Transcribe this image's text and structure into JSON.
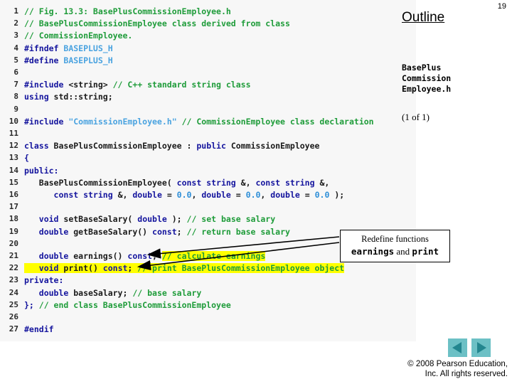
{
  "page": {
    "number": "19",
    "background": "#ffffff"
  },
  "outline": {
    "title": "Outline",
    "filename_lines": [
      "BasePlus",
      "Commission",
      "Employee.h"
    ],
    "count_label": "(1 of 1)"
  },
  "code_panel": {
    "background": "#f7f7f7",
    "highlight_color": "#ffff00",
    "lines": [
      {
        "n": "1",
        "segments": [
          {
            "t": "// Fig. 13.3: BasePlusCommissionEmployee.h",
            "c": "tok-com"
          }
        ]
      },
      {
        "n": "2",
        "segments": [
          {
            "t": "// BasePlusCommissionEmployee class derived from class",
            "c": "tok-com"
          }
        ]
      },
      {
        "n": "3",
        "segments": [
          {
            "t": "// CommissionEmployee.",
            "c": "tok-com"
          }
        ]
      },
      {
        "n": "4",
        "segments": [
          {
            "t": "#ifndef ",
            "c": "tok-pre"
          },
          {
            "t": "BASEPLUS_H",
            "c": "tok-macro"
          }
        ]
      },
      {
        "n": "5",
        "segments": [
          {
            "t": "#define ",
            "c": "tok-pre"
          },
          {
            "t": "BASEPLUS_H",
            "c": "tok-macro"
          }
        ]
      },
      {
        "n": "6",
        "segments": []
      },
      {
        "n": "7",
        "segments": [
          {
            "t": "#include ",
            "c": "tok-pre"
          },
          {
            "t": "<string>",
            "c": "tok-id"
          },
          {
            "t": " // C++ standard string class",
            "c": "tok-com"
          }
        ]
      },
      {
        "n": "8",
        "segments": [
          {
            "t": "using ",
            "c": "tok-key"
          },
          {
            "t": "std::string;",
            "c": "tok-id"
          }
        ]
      },
      {
        "n": "9",
        "segments": []
      },
      {
        "n": "10",
        "segments": [
          {
            "t": "#include ",
            "c": "tok-pre"
          },
          {
            "t": "\"CommissionEmployee.h\"",
            "c": "tok-str"
          },
          {
            "t": " // CommissionEmployee class declaration",
            "c": "tok-com"
          }
        ]
      },
      {
        "n": "11",
        "segments": []
      },
      {
        "n": "12",
        "segments": [
          {
            "t": "class ",
            "c": "tok-key"
          },
          {
            "t": "BasePlusCommissionEmployee : ",
            "c": "tok-id"
          },
          {
            "t": "public ",
            "c": "tok-key"
          },
          {
            "t": "CommissionEmployee",
            "c": "tok-id"
          }
        ]
      },
      {
        "n": "13",
        "segments": [
          {
            "t": "{",
            "c": "tok-key"
          }
        ]
      },
      {
        "n": "14",
        "segments": [
          {
            "t": "public:",
            "c": "tok-key"
          }
        ]
      },
      {
        "n": "15",
        "segments": [
          {
            "t": "   BasePlusCommissionEmployee( ",
            "c": "tok-id"
          },
          {
            "t": "const string ",
            "c": "tok-key"
          },
          {
            "t": "&, ",
            "c": "tok-id"
          },
          {
            "t": "const string ",
            "c": "tok-key"
          },
          {
            "t": "&,",
            "c": "tok-id"
          }
        ]
      },
      {
        "n": "16",
        "segments": [
          {
            "t": "      ",
            "c": "tok-id"
          },
          {
            "t": "const string ",
            "c": "tok-key"
          },
          {
            "t": "&, ",
            "c": "tok-id"
          },
          {
            "t": "double ",
            "c": "tok-key"
          },
          {
            "t": "= ",
            "c": "tok-id"
          },
          {
            "t": "0.0",
            "c": "tok-num"
          },
          {
            "t": ", ",
            "c": "tok-id"
          },
          {
            "t": "double ",
            "c": "tok-key"
          },
          {
            "t": "= ",
            "c": "tok-id"
          },
          {
            "t": "0.0",
            "c": "tok-num"
          },
          {
            "t": ", ",
            "c": "tok-id"
          },
          {
            "t": "double ",
            "c": "tok-key"
          },
          {
            "t": "= ",
            "c": "tok-id"
          },
          {
            "t": "0.0",
            "c": "tok-num"
          },
          {
            "t": " );",
            "c": "tok-id"
          }
        ]
      },
      {
        "n": "17",
        "segments": []
      },
      {
        "n": "18",
        "segments": [
          {
            "t": "   ",
            "c": "tok-id"
          },
          {
            "t": "void ",
            "c": "tok-key"
          },
          {
            "t": "setBaseSalary( ",
            "c": "tok-id"
          },
          {
            "t": "double ",
            "c": "tok-key"
          },
          {
            "t": "); ",
            "c": "tok-id"
          },
          {
            "t": "// set base salary",
            "c": "tok-com"
          }
        ]
      },
      {
        "n": "19",
        "segments": [
          {
            "t": "   ",
            "c": "tok-id"
          },
          {
            "t": "double ",
            "c": "tok-key"
          },
          {
            "t": "getBaseSalary() ",
            "c": "tok-id"
          },
          {
            "t": "const",
            "c": "tok-key"
          },
          {
            "t": "; ",
            "c": "tok-id"
          },
          {
            "t": "// return base salary",
            "c": "tok-com"
          }
        ]
      },
      {
        "n": "20",
        "segments": []
      },
      {
        "n": "21",
        "segments": [
          {
            "t": "   ",
            "c": "tok-id"
          },
          {
            "t": "double ",
            "c": "tok-key"
          },
          {
            "t": "earnings() ",
            "c": "tok-id"
          },
          {
            "t": "const",
            "c": "tok-key"
          },
          {
            "t": "; ",
            "c": "tok-id"
          },
          {
            "t": "// calculate earnings",
            "c": "tok-com",
            "hl": true
          }
        ]
      },
      {
        "n": "22",
        "segments": [
          {
            "t": "   ",
            "c": "tok-id",
            "hl": true
          },
          {
            "t": "void ",
            "c": "tok-key",
            "hl": true
          },
          {
            "t": "print() ",
            "c": "tok-id",
            "hl": true
          },
          {
            "t": "const",
            "c": "tok-key",
            "hl": true
          },
          {
            "t": "; ",
            "c": "tok-id",
            "hl": true
          },
          {
            "t": "// print BasePlusCommissionEmployee object",
            "c": "tok-com",
            "hl": true
          }
        ]
      },
      {
        "n": "23",
        "segments": [
          {
            "t": "private:",
            "c": "tok-key"
          }
        ]
      },
      {
        "n": "24",
        "segments": [
          {
            "t": "   ",
            "c": "tok-id"
          },
          {
            "t": "double ",
            "c": "tok-key"
          },
          {
            "t": "baseSalary; ",
            "c": "tok-id"
          },
          {
            "t": "// base salary",
            "c": "tok-com"
          }
        ]
      },
      {
        "n": "25",
        "segments": [
          {
            "t": "}; ",
            "c": "tok-key"
          },
          {
            "t": "// end class BasePlusCommissionEmployee",
            "c": "tok-com"
          }
        ]
      },
      {
        "n": "26",
        "segments": []
      },
      {
        "n": "27",
        "segments": [
          {
            "t": "#endif",
            "c": "tok-pre"
          }
        ]
      }
    ]
  },
  "callout": {
    "line1": "Redefine functions",
    "fn1": "earnings",
    "conjunction": " and ",
    "fn2": "print"
  },
  "navigation": {
    "prev_label": "previous-slide",
    "next_label": "next-slide",
    "button_color": "#6cc0c5",
    "arrow_color": "#23868f"
  },
  "footer": {
    "copyright_line1": "© 2008 Pearson Education,",
    "copyright_line2": "Inc.  All rights reserved."
  }
}
